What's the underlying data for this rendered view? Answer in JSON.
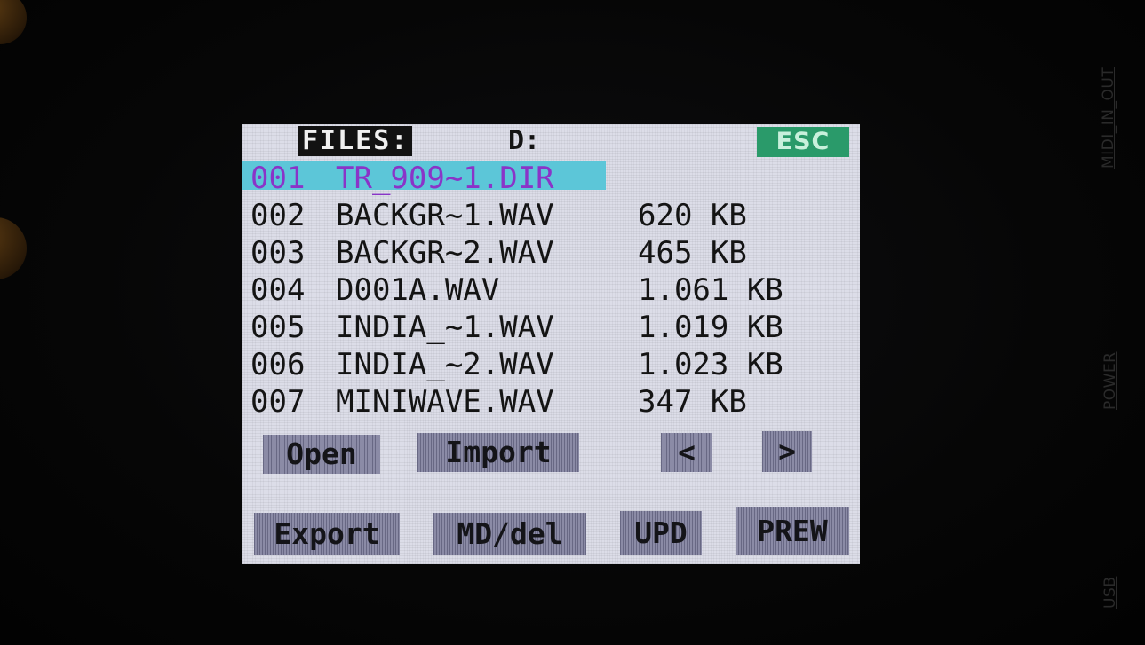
{
  "side_labels": {
    "midi": "MIDI_IN_OUT",
    "power": "POWER",
    "usb": "USB"
  },
  "header": {
    "files_label": "FILES:",
    "drive": "D:",
    "esc": "ESC"
  },
  "files": [
    {
      "num": "001",
      "name": "TR_909~1.DIR",
      "size": "",
      "selected": true
    },
    {
      "num": "002",
      "name": "BACKGR~1.WAV",
      "size": "620 KB"
    },
    {
      "num": "003",
      "name": "BACKGR~2.WAV",
      "size": "465 KB"
    },
    {
      "num": "004",
      "name": "D001A.WAV",
      "size": "1.061 KB"
    },
    {
      "num": "005",
      "name": "INDIA_~1.WAV",
      "size": "1.019 KB"
    },
    {
      "num": "006",
      "name": "INDIA_~2.WAV",
      "size": "1.023 KB"
    },
    {
      "num": "007",
      "name": "MINIWAVE.WAV",
      "size": "347 KB"
    }
  ],
  "buttons_row1": {
    "open": "Open",
    "import": "Import",
    "prev": "<",
    "next": ">"
  },
  "buttons_row2": {
    "export": "Export",
    "mddel": "MD/del",
    "upd": "UPD",
    "prew": "PREW"
  },
  "colors": {
    "screen_bg": "#dcdde8",
    "selection_bar": "#5cc6d8",
    "selected_text": "#8a34c8",
    "esc_bg": "#2a9a6a",
    "button_bg": "#8b8ba6"
  }
}
